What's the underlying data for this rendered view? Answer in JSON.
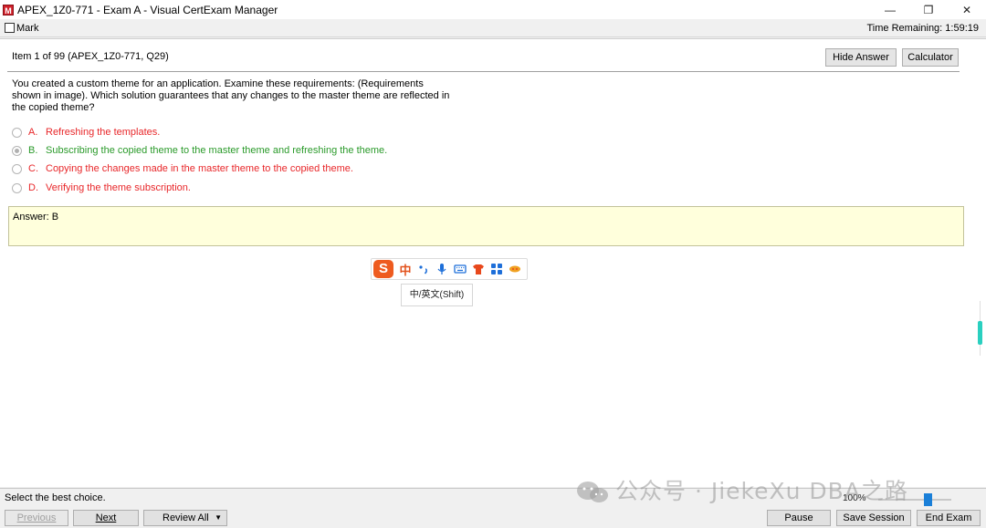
{
  "window": {
    "title": "APEX_1Z0-771 - Exam A - Visual CertExam Manager",
    "minimize": "—",
    "restore": "❐",
    "close": "✕"
  },
  "markbar": {
    "mark_label": "Mark",
    "time_remaining": "Time Remaining: 1:59:19"
  },
  "item": {
    "header": "Item 1 of 99  (APEX_1Z0-771, Q29)",
    "hide_answer": "Hide Answer",
    "calculator": "Calculator",
    "question": "You created a custom theme for an application. Examine these requirements: (Requirements shown in image). Which solution guarantees that any changes to the master theme are reflected in the copied theme?",
    "choices": [
      {
        "letter": "A.",
        "text": "Refreshing the templates.",
        "selected": false
      },
      {
        "letter": "B.",
        "text": "Subscribing the copied theme to the master theme and refreshing the theme.",
        "selected": true
      },
      {
        "letter": "C.",
        "text": "Copying the changes made in the master theme to the copied theme.",
        "selected": false
      },
      {
        "letter": "D.",
        "text": "Verifying the theme subscription.",
        "selected": false
      }
    ],
    "answer": "Answer: B"
  },
  "ime": {
    "logo": "S",
    "mode": "中",
    "tooltip": "中/英文(Shift)"
  },
  "status": {
    "text": "Select the best choice.",
    "zoom": "100%"
  },
  "buttons": {
    "previous": "Previous",
    "next": "Next",
    "review_all": "Review All",
    "pause": "Pause",
    "save_session": "Save Session",
    "end_exam": "End Exam"
  },
  "watermark": "公众号 · JiekeXu DBA之路",
  "colors": {
    "wrong": "#e8272a",
    "correct": "#2a9a2a",
    "answer_bg": "#ffffdc"
  }
}
